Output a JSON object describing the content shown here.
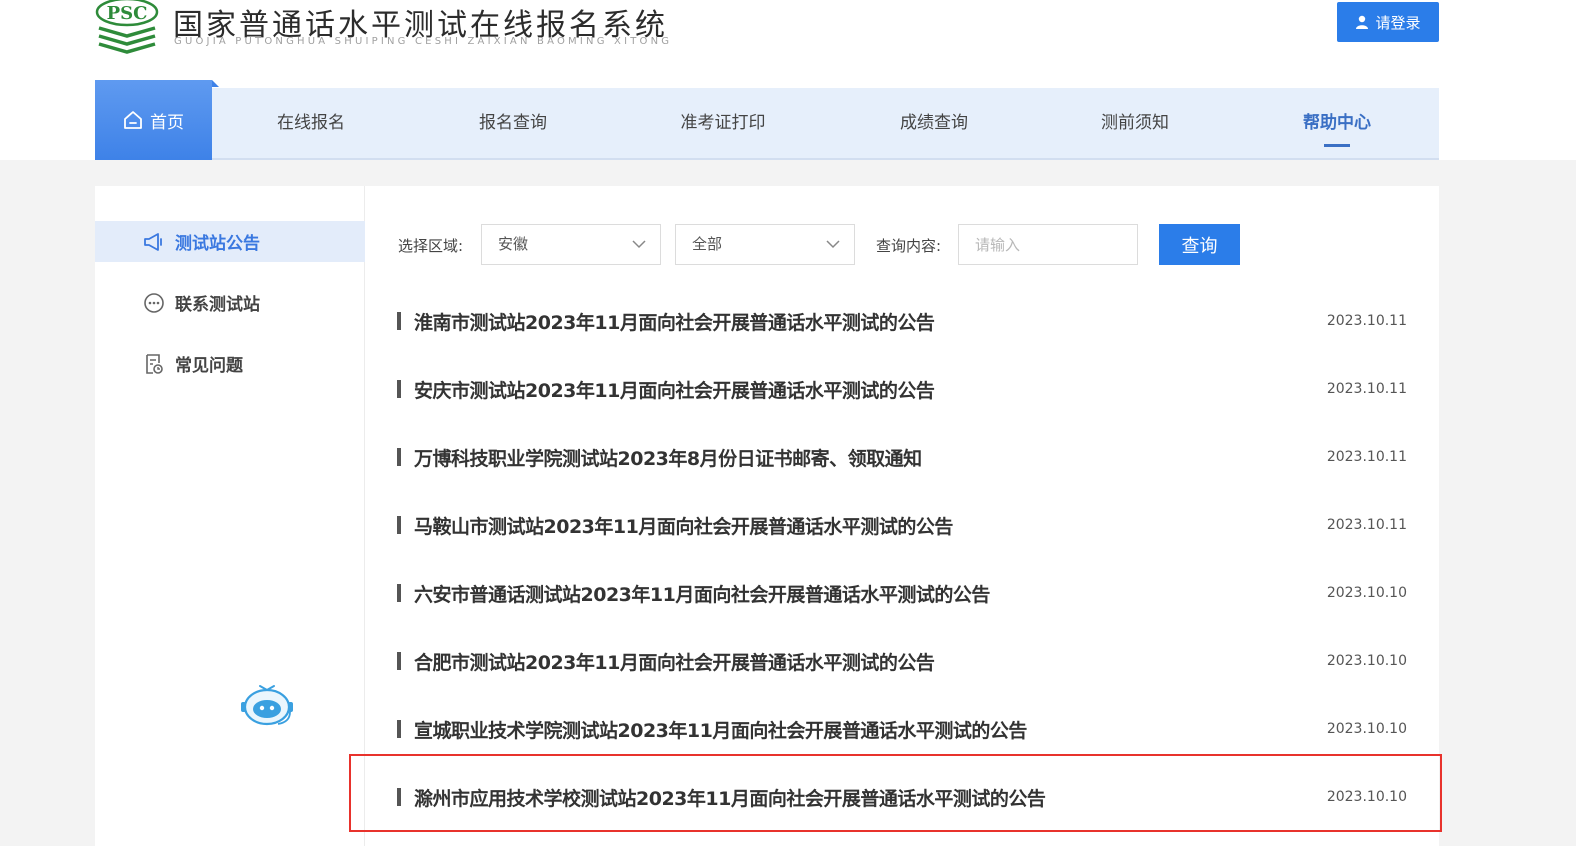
{
  "header": {
    "title": "国家普通话水平测试在线报名系统",
    "subtitle": "GUOJIA PUTONGHUA SHUIPING CESHI ZAIXIAN BAOMING XITONG",
    "logo_text": "PSC",
    "login_label": "请登录"
  },
  "nav": {
    "home_label": "首页",
    "items": [
      {
        "label": "在线报名"
      },
      {
        "label": "报名查询"
      },
      {
        "label": "准考证打印"
      },
      {
        "label": "成绩查询"
      },
      {
        "label": "测前须知"
      },
      {
        "label": "帮助中心"
      }
    ],
    "active": "帮助中心"
  },
  "sidebar": {
    "items": [
      {
        "label": "测试站公告",
        "icon": "megaphone-icon"
      },
      {
        "label": "联系测试站",
        "icon": "chat-icon"
      },
      {
        "label": "常见问题",
        "icon": "document-icon"
      }
    ],
    "active": "测试站公告"
  },
  "filter": {
    "region_label": "选择区域:",
    "region_value": "安徽",
    "category_value": "全部",
    "query_label": "查询内容:",
    "search_placeholder": "请输入",
    "search_value": "",
    "query_button": "查询"
  },
  "announcements": [
    {
      "title": "淮南市测试站2023年11月面向社会开展普通话水平测试的公告",
      "date": "2023.10.11"
    },
    {
      "title": "安庆市测试站2023年11月面向社会开展普通话水平测试的公告",
      "date": "2023.10.11"
    },
    {
      "title": "万博科技职业学院测试站2023年8月份日证书邮寄、领取通知",
      "date": "2023.10.11"
    },
    {
      "title": "马鞍山市测试站2023年11月面向社会开展普通话水平测试的公告",
      "date": "2023.10.11"
    },
    {
      "title": "六安市普通话测试站2023年11月面向社会开展普通话水平测试的公告",
      "date": "2023.10.10"
    },
    {
      "title": "合肥市测试站2023年11月面向社会开展普通话水平测试的公告",
      "date": "2023.10.10"
    },
    {
      "title": "宣城职业技术学院测试站2023年11月面向社会开展普通话水平测试的公告",
      "date": "2023.10.10"
    },
    {
      "title": "滁州市应用技术学校测试站2023年11月面向社会开展普通话水平测试的公告",
      "date": "2023.10.10"
    }
  ],
  "colors": {
    "primary": "#2b7de9",
    "nav_bg": "#e6effb",
    "active_text": "#3a6fc4",
    "highlight": "#e8322c",
    "logo_green": "#2e8b3a"
  }
}
